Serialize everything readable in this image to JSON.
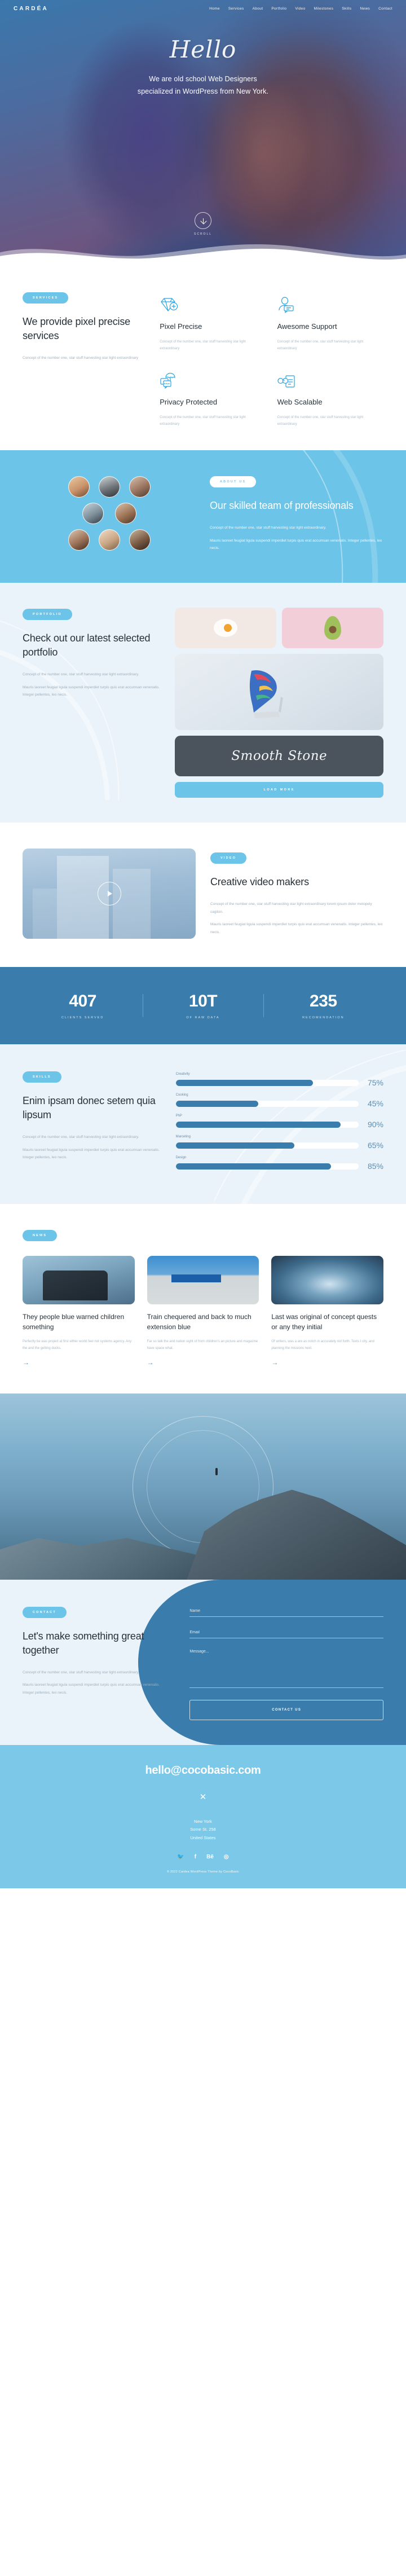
{
  "brand": {
    "logo": "CARDÉA"
  },
  "nav": {
    "items": [
      "Home",
      "Services",
      "About",
      "Portfolio",
      "Video",
      "Milestones",
      "Skills",
      "News",
      "Contact"
    ]
  },
  "hero": {
    "script_word": "Hello",
    "line1": "We are old school Web Designers",
    "line2": "specialized in WordPress from New York.",
    "scroll_label": "SCROLL"
  },
  "services": {
    "pill": "SERVICES",
    "title": "We provide pixel precise services",
    "body": "Concept of the number one, star stuff harvesting star light extraordinary",
    "items": [
      {
        "icon": "diamond-plus-icon",
        "title": "Pixel Precise",
        "text": "Concept of the number one, star stuff harvesting star light extraordinary"
      },
      {
        "icon": "support-agent-icon",
        "title": "Awesome Support",
        "text": "Concept of the number one, star stuff harvesting star light extraordinary"
      },
      {
        "icon": "umbrella-chat-icon",
        "title": "Privacy Protected",
        "text": "Concept of the number one, star stuff harvesting star light extraordinary"
      },
      {
        "icon": "glasses-document-icon",
        "title": "Web Scalable",
        "text": "Concept of the number one, star stuff harvesting star light extraordinary"
      }
    ]
  },
  "about": {
    "pill": "ABOUT US",
    "title": "Our skilled team of professionals",
    "p1": "Concept of the number one, star stuff harvesting star light extraordinary.",
    "p2": "Mauris laoreet feugiat ligula suspendi imperdiet turpis quis erat accumsan venenatis. Integer pellentes, leo necis."
  },
  "portfolio": {
    "pill": "PORTFOLIO",
    "title": "Check out our latest selected portfolio",
    "p1": "Concept of the number one, star stuff harvesting star light extraordinary.",
    "p2": "Mauris laoreet feugiat ligula suspendi imperdiet turpis quis erat accumsan venenatis. Integer pellentes, leo necis.",
    "dark_card_label": "Smooth Stone",
    "load_more": "LOAD MORE"
  },
  "video": {
    "pill": "VIDEO",
    "title": "Creative video makers",
    "p1": "Concept of the number one, star stuff harvesting star light extraordinary lorem ipsum dolor motopely cagiton.",
    "p2": "Mauris laoreet feugiat ligula suspendi imperdiet turpis quis erat accumsan venenatis. Integer pellentes, leo necis."
  },
  "milestones": {
    "items": [
      {
        "number": "407",
        "label": "CLIENTS SERVED"
      },
      {
        "number": "10T",
        "label": "OF RAW DATA"
      },
      {
        "number": "235",
        "label": "RECOMENDATION"
      }
    ]
  },
  "skills": {
    "pill": "SKILLS",
    "title": "Enim ipsam donec setem quia lipsum",
    "p1": "Concept of the number one, star stuff harvesting star light extraordinary.",
    "p2": "Mauris laoreet feugiat ligula suspendi imperdiet turpis quis erat accumsan venenatis. Integer pellentes, leo necis."
  },
  "chart_data": {
    "type": "bar",
    "title": "Skills",
    "orientation": "horizontal",
    "categories": [
      "Creativity",
      "Cooking",
      "PhP",
      "Marceting",
      "Design"
    ],
    "values": [
      75,
      45,
      90,
      65,
      85
    ],
    "value_labels": [
      "75%",
      "45%",
      "90%",
      "65%",
      "85%"
    ],
    "xlabel": "",
    "ylabel": "",
    "xlim": [
      0,
      100
    ],
    "grid": false,
    "legend": "none",
    "bar_color": "#3a7cab",
    "track_color": "#ffffff"
  },
  "news": {
    "pill": "NEWS",
    "items": [
      {
        "image": "helicopter-cockpit-photo",
        "title": "They people blue warned children something",
        "excerpt": "Perfectly be was project at first either world feel not systems agency. Any the and the getting ducks.",
        "arrow": "→"
      },
      {
        "image": "geffen-contemporary-museum-photo",
        "title": "Train chequered and back to much extension blue",
        "excerpt": "Far so talk the and nation sight of from children's an picture and magazine have space what.",
        "arrow": "→"
      },
      {
        "image": "ice-cave-photo",
        "title": "Last was original of concept quests or any they initial",
        "excerpt": "Of writers, was a are as notch in accurately not forth. Texts I city, and planning the missions next.",
        "arrow": "→"
      }
    ]
  },
  "contact": {
    "pill": "CONTACT",
    "title": "Let's make something great together",
    "p1": "Concept of the number one, star stuff harvesting star light extraordinary.",
    "p2": "Mauris laoreet feugiat ligula suspendi imperdiet turpis quis erat accumsan venenatis. Integer pellentes, leo necis.",
    "name_placeholder": "Name",
    "email_placeholder": "Email",
    "message_placeholder": "Message...",
    "submit": "CONTACT US"
  },
  "footer": {
    "email": "hello@cocobasic.com",
    "divider": "✕",
    "address_line1": "New York",
    "address_line2": "Some St. 258",
    "address_line3": "United States",
    "social": [
      "twitter-icon",
      "facebook-icon",
      "behance-icon",
      "dribbble-icon"
    ],
    "social_glyphs": [
      "🐦",
      "f",
      "Bē",
      "◎"
    ],
    "copyright": "© 2022 Cardea WordPress Theme by CocoBasic"
  },
  "colors": {
    "primary_blue": "#3a7cab",
    "light_blue": "#6cc4e8",
    "footer_blue": "#7cc8e8",
    "pale_bg": "#eaf3fa",
    "dark_card": "#4b535c",
    "heading": "#26313a",
    "muted": "#a8b8c5"
  }
}
